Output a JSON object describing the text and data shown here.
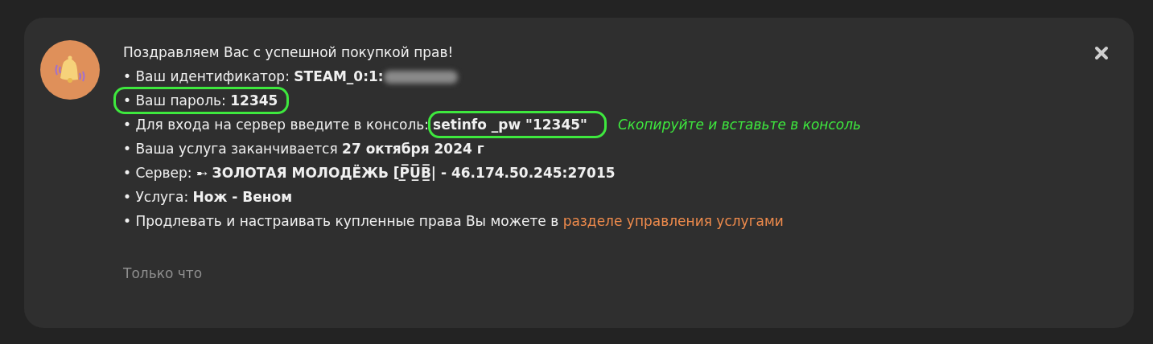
{
  "notification": {
    "title": "Поздравляем Вас с успешной покупкой прав!",
    "lines": [
      {
        "text": "• Ваш идентификатор: **STEAM_0:1:**",
        "redacted": true,
        "highlighted": false
      },
      {
        "text": "• Ваш пароль: **12345**",
        "highlighted": true
      },
      {
        "text": "• Для входа на сервер введите в консоль:",
        "value": "setinfo _pw \"12345\"",
        "highlighted": false,
        "value_highlighted": true,
        "note": "Скопируйте и вставьте в консоль"
      },
      {
        "text": "• Ваша услуга заканчивается **27 октября 2024 г**",
        "highlighted": false
      },
      {
        "text": "• Сервер: ➸ **ЗОЛОТАЯ МОЛОДЁЖЬ [P̲̅U̲̅B̲̅| - 46.174.50.245:27015**",
        "highlighted": false
      },
      {
        "text": "• Услуга: **Нож - Веном**",
        "highlighted": false
      }
    ],
    "footer_text": "• Продлевать и настраивать купленные права Вы можете в ",
    "footer_link": "разделе управления услугами",
    "time": "Только что"
  }
}
